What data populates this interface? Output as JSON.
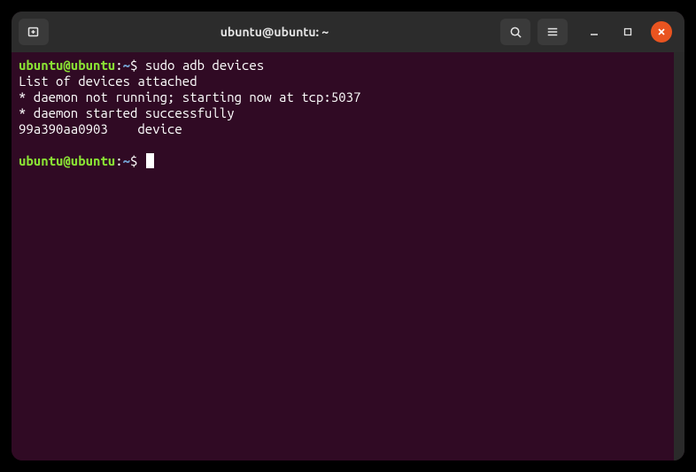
{
  "window": {
    "title": "ubuntu@ubuntu: ~"
  },
  "prompt": {
    "user_host": "ubuntu@ubuntu",
    "separator": ":",
    "path": "~",
    "symbol": "$"
  },
  "session": {
    "command1": "sudo adb devices",
    "output": [
      "List of devices attached",
      "* daemon not running; starting now at tcp:5037",
      "* daemon started successfully",
      "99a390aa0903    device"
    ]
  }
}
